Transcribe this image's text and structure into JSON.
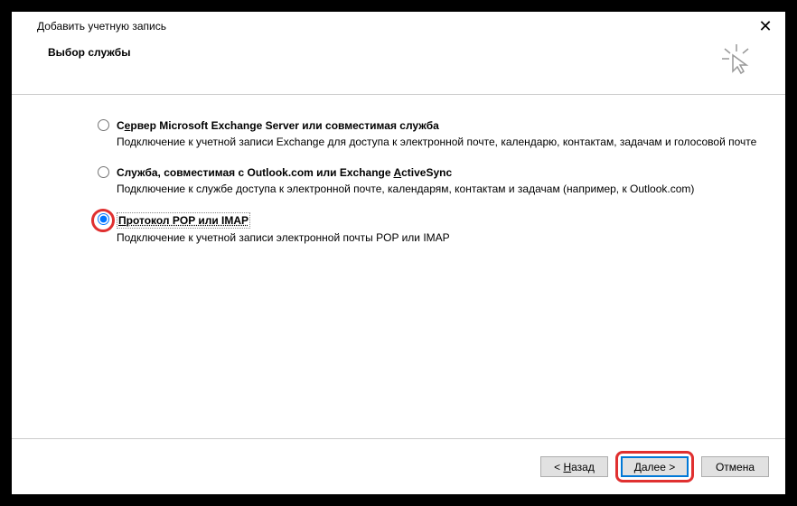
{
  "titlebar": {
    "title": "Добавить учетную запись"
  },
  "header": {
    "title": "Выбор службы"
  },
  "options": {
    "opt1": {
      "title_before_u": "С",
      "title_u": "е",
      "title_after_u": "рвер Microsoft Exchange Server или совместимая служба",
      "desc": "Подключение к учетной записи Exchange для доступа к электронной почте, календарю, контактам, задачам и голосовой почте"
    },
    "opt2": {
      "title_before_u": "Служба, совместимая с Outlook.com или Exchange ",
      "title_u": "A",
      "title_after_u": "ctiveSync",
      "desc": "Подключение к службе доступа к электронной почте, календарям, контактам и задачам (например, к Outlook.com)"
    },
    "opt3": {
      "title_before_u": "",
      "title_u": "П",
      "title_after_u": "ротокол POP или IMAP",
      "desc": "Подключение к учетной записи электронной почты POP или IMAP"
    }
  },
  "footer": {
    "back_before": "< ",
    "back_u": "Н",
    "back_after": "азад",
    "next_before": "",
    "next_u": "Д",
    "next_after": "алее >",
    "cancel": "Отмена"
  }
}
